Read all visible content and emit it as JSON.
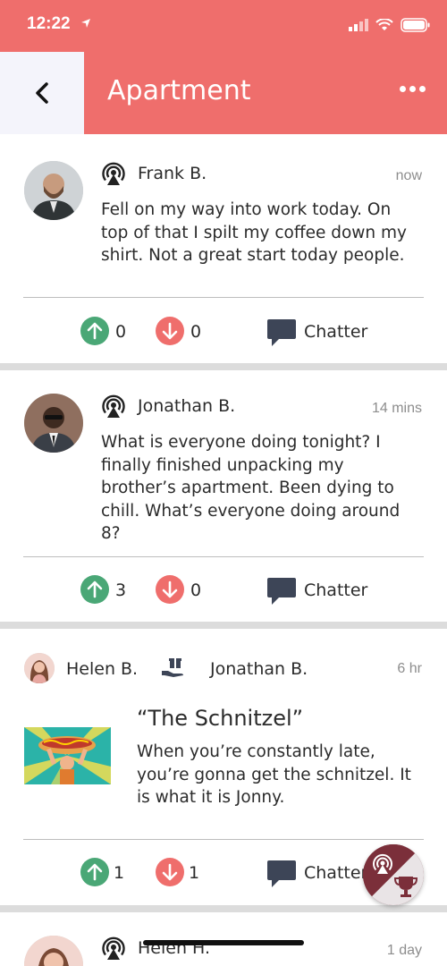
{
  "status": {
    "time": "12:22"
  },
  "header": {
    "title": "Apartment",
    "accent": "#ef6e6c"
  },
  "posts": [
    {
      "author": "Frank B.",
      "time": "now",
      "text": "Fell on my way into work today. On top of that I spilt my coffee down my shirt. Not a great start today people.",
      "upvotes": "0",
      "downvotes": "0",
      "chatter_label": "Chatter"
    },
    {
      "author": "Jonathan B.",
      "time": "14 mins",
      "text": "What is everyone doing tonight? I finally finished unpacking my brother’s apartment. Been dying to chill. What’s everyone doing around 8?",
      "upvotes": "3",
      "downvotes": "0",
      "chatter_label": "Chatter"
    },
    {
      "from": "Helen B.",
      "to": "Jonathan B.",
      "time": "6 hr",
      "award_title": "“The Schnitzel”",
      "text": "When you’re constantly late, you’re gonna get the schnitzel. It is what it is Jonny.",
      "upvotes": "1",
      "downvotes": "1",
      "chatter_label": "Chatter"
    },
    {
      "author": "Helen H.",
      "time": "1 day"
    }
  ],
  "icons": {
    "back": "chevron-left-icon",
    "more": "more-horizontal-icon",
    "broadcast": "broadcast-icon",
    "gift": "gift-hand-icon",
    "upvote": "arrow-up-icon",
    "downvote": "arrow-down-icon",
    "chatter": "chat-bubble-icon",
    "fab": "broadcast-trophy-icon"
  },
  "colors": {
    "up": "#4aa776",
    "down": "#ef6e6c",
    "chat": "#3d4557",
    "fab": "#7b2f3a"
  }
}
